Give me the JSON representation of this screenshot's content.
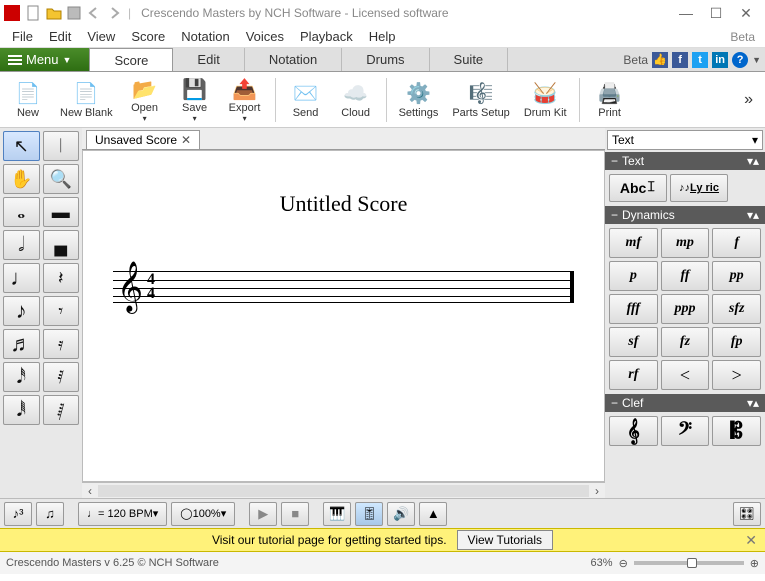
{
  "title": "Crescendo Masters by NCH Software - Licensed software",
  "menubar": [
    "File",
    "Edit",
    "View",
    "Score",
    "Notation",
    "Voices",
    "Playback",
    "Help"
  ],
  "menubar_beta": "Beta",
  "menu_button": "Menu",
  "ribbon_tabs": [
    "Score",
    "Edit",
    "Notation",
    "Drums",
    "Suite"
  ],
  "ribbon_beta": "Beta",
  "toolbar": {
    "new": "New",
    "new_blank": "New Blank",
    "open": "Open",
    "save": "Save",
    "export": "Export",
    "send": "Send",
    "cloud": "Cloud",
    "settings": "Settings",
    "parts": "Parts Setup",
    "drumkit": "Drum Kit",
    "print": "Print"
  },
  "doc_tab": "Unsaved Score",
  "score_title": "Untitled Score",
  "right": {
    "combo": "Text",
    "text_header": "Text",
    "text_btn1": "Abc",
    "text_btn2": "Ly  ric",
    "dyn_header": "Dynamics",
    "dynamics": [
      "mf",
      "mp",
      "f",
      "p",
      "ff",
      "pp",
      "fff",
      "ppp",
      "sfz",
      "sf",
      "fz",
      "fp",
      "rf",
      "<",
      ">"
    ],
    "clef_header": "Clef"
  },
  "bottom": {
    "bpm": "= 120 BPM",
    "zoom": "100%"
  },
  "tutorial": {
    "text": "Visit our tutorial page for getting started tips.",
    "btn": "View Tutorials"
  },
  "status_text": "Crescendo Masters v 6.25 © NCH Software",
  "status_zoom": "63%"
}
